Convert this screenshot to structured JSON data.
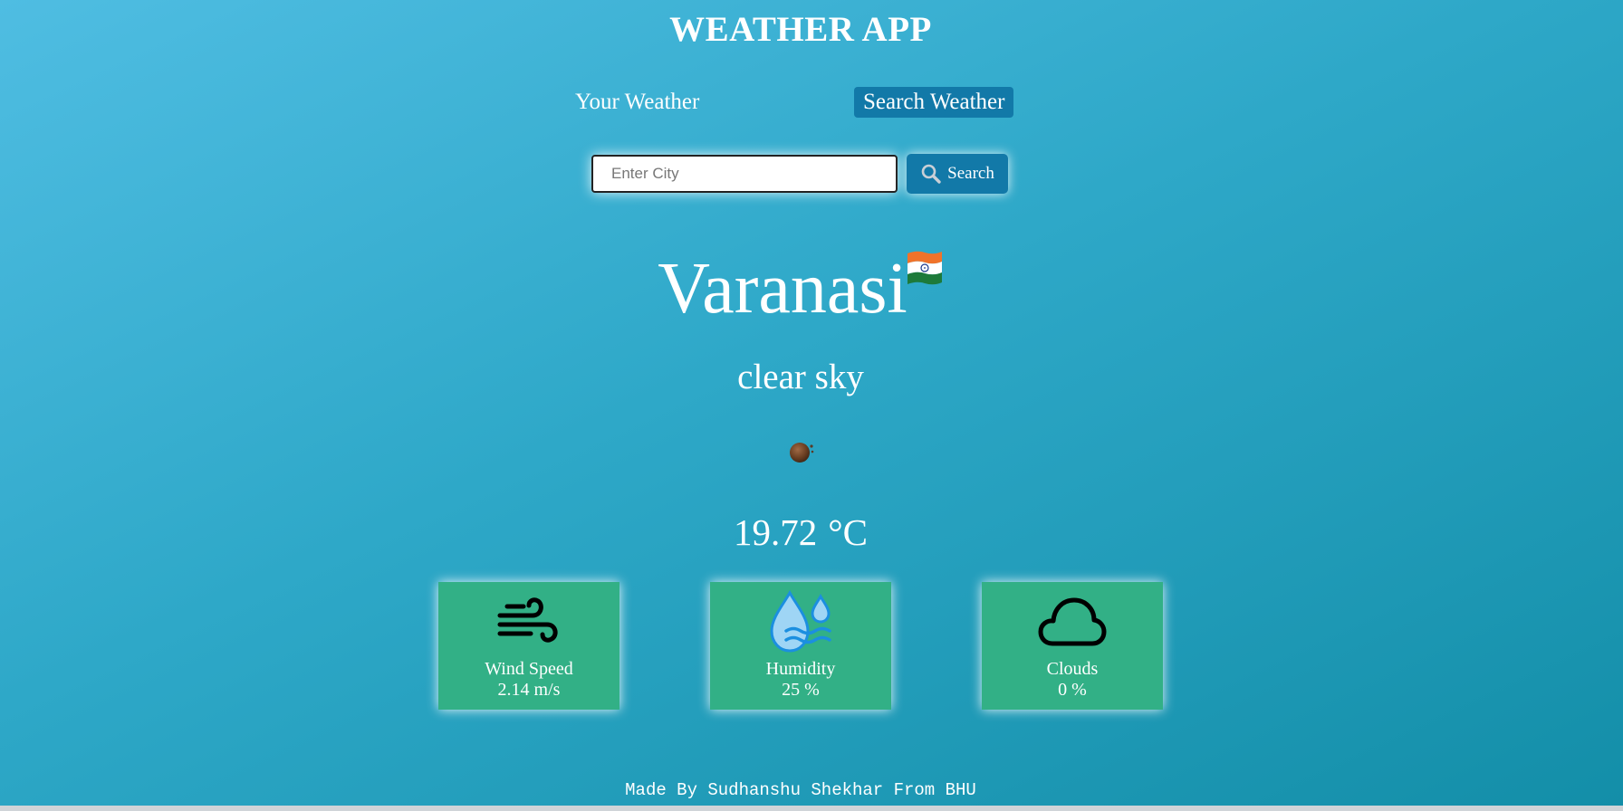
{
  "header": {
    "title": "WEATHER APP"
  },
  "tabs": [
    {
      "label": "Your Weather",
      "active": false
    },
    {
      "label": "Search Weather",
      "active": true
    }
  ],
  "search": {
    "placeholder": "Enter City",
    "value": "",
    "button_label": "Search",
    "button_icon": "search-icon"
  },
  "weather": {
    "city": "Varanasi",
    "country_flag_icon": "india-flag-icon",
    "description": "clear sky",
    "condition_icon": "clear-night-icon",
    "temperature_value": "19.72",
    "temperature_unit": "°C"
  },
  "stats": [
    {
      "icon": "wind-icon",
      "label": "Wind Speed",
      "value": "2.14 m/s"
    },
    {
      "icon": "humidity-icon",
      "label": "Humidity",
      "value": "25 %"
    },
    {
      "icon": "cloud-icon",
      "label": "Clouds",
      "value": "0 %"
    }
  ],
  "footer": {
    "text": "Made By Sudhanshu Shekhar From BHU"
  },
  "colors": {
    "background_start": "#4fbde2",
    "background_end": "#138ea8",
    "accent_button": "#1279a8",
    "card_background": "#32b086",
    "text": "#ffffff"
  }
}
